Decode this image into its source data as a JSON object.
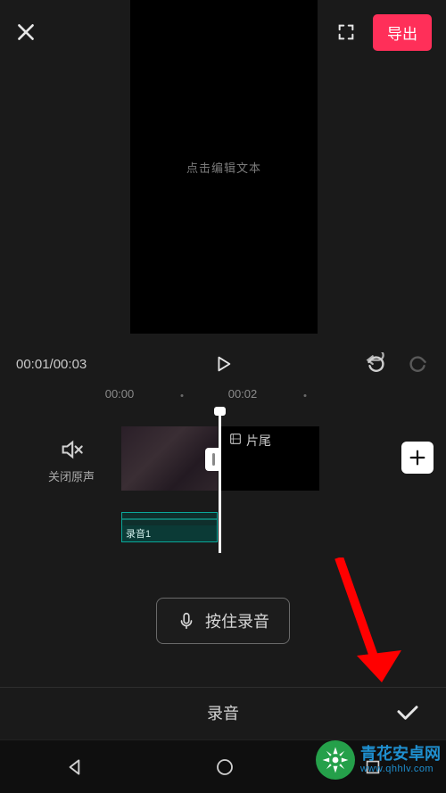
{
  "topbar": {
    "export_label": "导出"
  },
  "preview": {
    "placeholder_text": "点击编辑文本"
  },
  "playback": {
    "current_time": "00:01",
    "total_time": "00:03"
  },
  "ruler": {
    "marks": [
      "00:00",
      "00:02"
    ]
  },
  "mute": {
    "label": "关闭原声"
  },
  "clips": {
    "tail_label": "片尾",
    "audio_label": "录音1"
  },
  "record": {
    "hold_label": "按住录音"
  },
  "panel": {
    "title": "录音"
  },
  "watermark": {
    "name_cn": "青花安卓网",
    "domain": "www.qhhlv.com"
  }
}
